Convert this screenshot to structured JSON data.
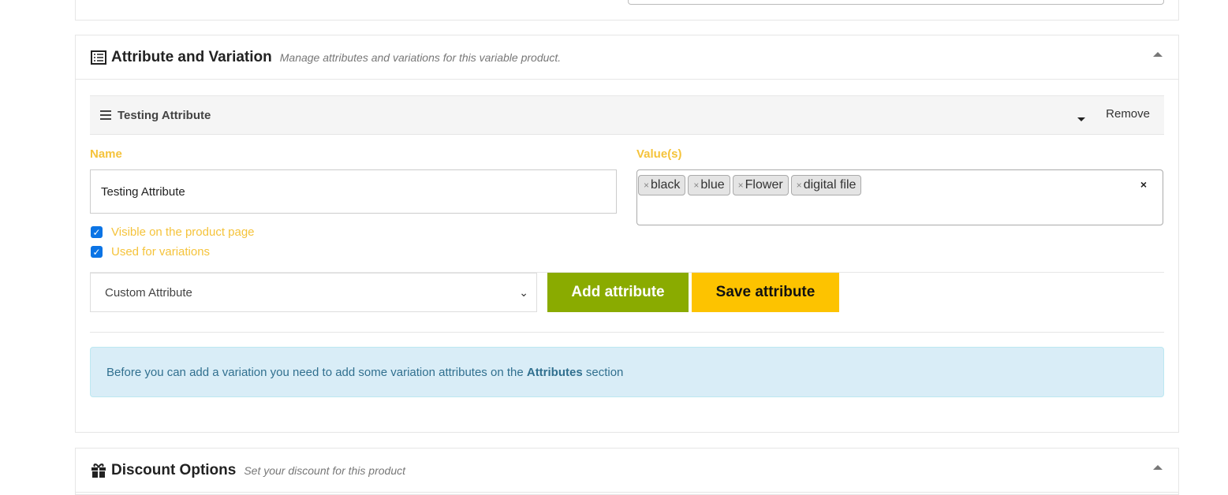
{
  "attribute_section": {
    "title": "Attribute and Variation",
    "subtitle": "Manage attributes and variations for this variable product.",
    "attribute": {
      "title": "Testing Attribute",
      "remove_label": "Remove",
      "name_label": "Name",
      "name_value": "Testing Attribute",
      "values_label": "Value(s)",
      "values": [
        "black",
        "blue",
        "Flower",
        "digital file"
      ],
      "clear_symbol": "×",
      "visible_label": "Visible on the product page",
      "visible_checked": true,
      "variations_label": "Used for variations",
      "variations_checked": true
    },
    "attribute_select": "Custom Attribute",
    "add_button": "Add attribute",
    "save_button": "Save attribute",
    "info": {
      "before": "Before you can add a variation you need to add some variation attributes on the ",
      "bold": "Attributes",
      "after": " section"
    },
    "colors": {
      "add": "#8aab00",
      "save": "#fdc300",
      "label": "#f5c33b"
    }
  },
  "discount_section": {
    "title": "Discount Options",
    "subtitle": "Set your discount for this product"
  }
}
